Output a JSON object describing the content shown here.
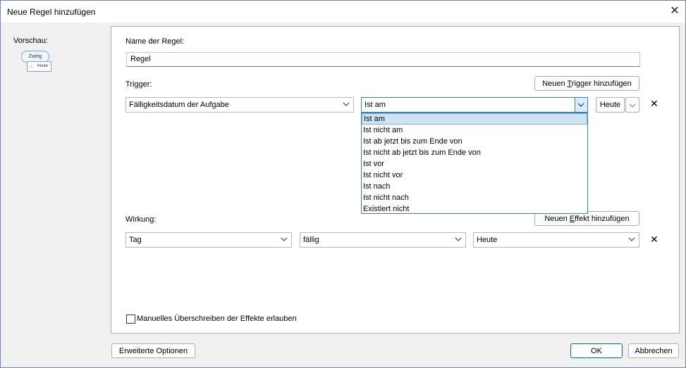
{
  "window": {
    "title": "Neue Regel hinzufügen"
  },
  "preview": {
    "label": "Vorschau:",
    "node1": "Zweig",
    "node2": "heute"
  },
  "rule": {
    "name_label": "Name der Regel:",
    "name_value": "Regel"
  },
  "trigger": {
    "label": "Trigger:",
    "add_button": {
      "pre": "Neuen ",
      "ul": "T",
      "post": "rigger hinzufügen"
    },
    "field": "Fälligkeitsdatum der Aufgabe",
    "operator": "Ist am",
    "value_button": "Heute",
    "operator_options": [
      "Ist am",
      "Ist nicht am",
      "Ist ab jetzt bis zum Ende von",
      "Ist nicht ab jetzt bis zum Ende von",
      "Ist vor",
      "Ist nicht vor",
      "Ist nach",
      "Ist nicht nach",
      "Existiert nicht"
    ]
  },
  "effect": {
    "label": "Wirkung:",
    "add_button": {
      "pre": "Neuen ",
      "ul": "E",
      "post": "ffekt hinzufügen"
    },
    "field": "Tag",
    "operator": "fällig",
    "value": "Heute"
  },
  "override_checkbox": {
    "label": "Manuelles Überschreiben der Effekte erlauben",
    "checked": false
  },
  "footer": {
    "advanced": "Erweiterte Optionen",
    "ok": "OK",
    "cancel": "Abbrechen"
  }
}
